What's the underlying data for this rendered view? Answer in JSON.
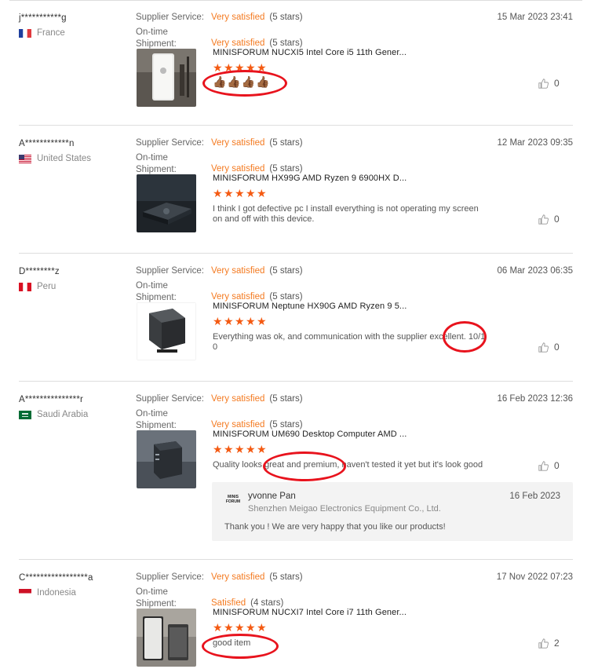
{
  "labels": {
    "supplier_service": "Supplier Service:",
    "on_time": "On-time",
    "shipment": "Shipment:"
  },
  "reviews": [
    {
      "user": "j***********g",
      "country": "France",
      "supplier_rating": "Very satisfied",
      "supplier_stars": "(5 stars)",
      "shipment_rating": "Very satisfied",
      "shipment_stars": "(5 stars)",
      "date": "15 Mar 2023 23:41",
      "product_title": "MINISFORUM NUCXI5 Intel Core i5 11th Gener...",
      "stars": 5,
      "text": "👍🏾👍🏾👍🏾👍🏾",
      "helpful": "0"
    },
    {
      "user": "A************n",
      "country": "United States",
      "supplier_rating": "Very satisfied",
      "supplier_stars": "(5 stars)",
      "shipment_rating": "Very satisfied",
      "shipment_stars": "(5 stars)",
      "date": "12 Mar 2023 09:35",
      "product_title": "MINISFORUM HX99G AMD Ryzen 9 6900HX D...",
      "stars": 5,
      "text_line1": "I think I got defective pc I install everything is not operating my screen",
      "text_line2": "on and off with this device.",
      "helpful": "0"
    },
    {
      "user": "D********z",
      "country": "Peru",
      "supplier_rating": "Very satisfied",
      "supplier_stars": "(5 stars)",
      "shipment_rating": "Very satisfied",
      "shipment_stars": "(5 stars)",
      "date": "06 Mar 2023 06:35",
      "product_title": "MINISFORUM Neptune HX90G AMD Ryzen 9 5...",
      "stars": 5,
      "text_line1": "Everything was ok, and communication with the supplier excellent. 10/1",
      "text_line2": "0",
      "helpful": "0"
    },
    {
      "user": "A***************r",
      "country": "Saudi Arabia",
      "supplier_rating": "Very satisfied",
      "supplier_stars": "(5 stars)",
      "shipment_rating": "Very satisfied",
      "shipment_stars": "(5 stars)",
      "date": "16 Feb 2023 12:36",
      "product_title": "MINISFORUM UM690 Desktop Computer AMD ...",
      "stars": 5,
      "text": "Quality looks great and premium, haven't tested it yet but it's look good",
      "helpful": "0",
      "reply": {
        "logo_text": "MINIS FORUM",
        "name": "yvonne Pan",
        "company": "Shenzhen Meigao Electronics Equipment Co., Ltd.",
        "date": "16 Feb 2023",
        "text": "Thank you ! We are very happy that you like our products!"
      }
    },
    {
      "user": "C*****************a",
      "country": "Indonesia",
      "supplier_rating": "Very satisfied",
      "supplier_stars": "(5 stars)",
      "shipment_rating": "Satisfied",
      "shipment_stars": "(4 stars)",
      "date": "17 Nov 2022 07:23",
      "product_title": "MINISFORUM NUCXI7 Intel Core i7 11th Gener...",
      "stars": 5,
      "text": "good item",
      "helpful": "2"
    }
  ],
  "colors": {
    "accent": "#f47a20",
    "star": "#f45a12",
    "annotation": "#e8131d"
  },
  "icons": {
    "helpful": "thumbs-up-icon",
    "star": "star-icon"
  }
}
